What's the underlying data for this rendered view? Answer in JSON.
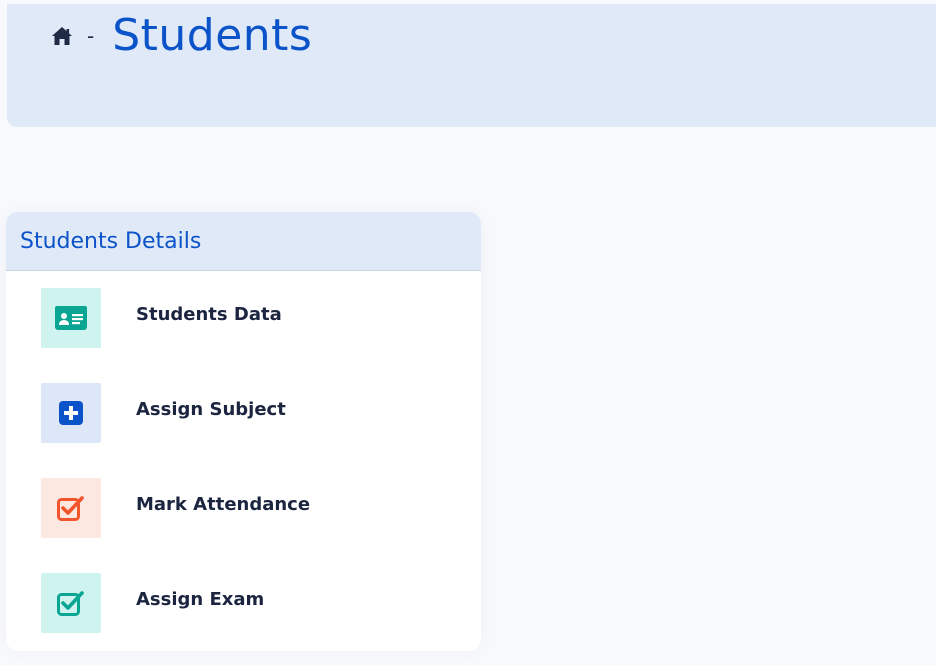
{
  "breadcrumb": {
    "home_icon": "home-icon",
    "separator": "-",
    "title": "Students"
  },
  "card": {
    "title": "Students Details",
    "items": [
      {
        "label": "Students Data",
        "icon": "id-card-icon",
        "tile_color": "#cff4ef",
        "icon_color": "#0aa593"
      },
      {
        "label": "Assign Subject",
        "icon": "plus-square-icon",
        "tile_color": "#dde7f7",
        "icon_color": "#0b53c9"
      },
      {
        "label": "Mark Attendance",
        "icon": "check-square-icon",
        "tile_color": "#fde7e1",
        "icon_color": "#f2552c"
      },
      {
        "label": "Assign Exam",
        "icon": "check-square-icon",
        "tile_color": "#cff4ef",
        "icon_color": "#0aa593"
      }
    ]
  },
  "colors": {
    "accent": "#0b53c9",
    "header_bg": "#e0e9f8",
    "text_dark": "#1c2540"
  }
}
